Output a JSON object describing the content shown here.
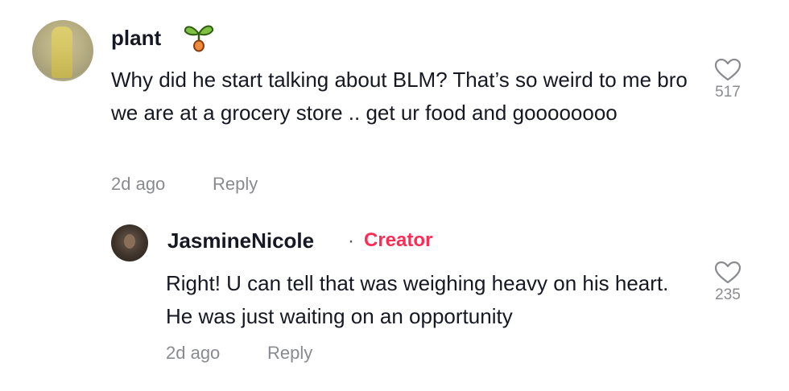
{
  "comment": {
    "username": "plant",
    "badge_icon": "sprout-icon",
    "text": "Why did he start talking about BLM? That’s so weird to me bro we are at a grocery store .. get ur food and goooooooo",
    "time": "2d ago",
    "reply_label": "Reply",
    "like_count": "517"
  },
  "reply": {
    "username": "JasmineNicole",
    "separator": "·",
    "role": "Creator",
    "text": "Right! U can tell that was weighing heavy on his heart. He was just waiting on an opportunity",
    "time": "2d ago",
    "reply_label": "Reply",
    "like_count": "235"
  },
  "colors": {
    "creator_accent": "#fe2c55",
    "muted_text": "#8a8b91",
    "primary_text": "#161823"
  }
}
